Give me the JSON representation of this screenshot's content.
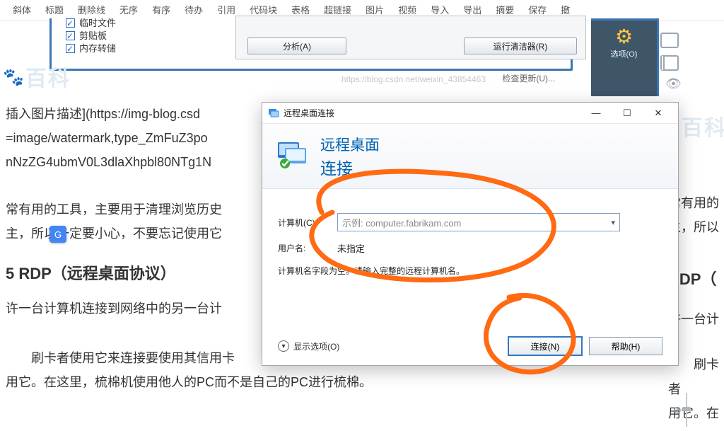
{
  "toolbar": {
    "items": [
      "斜体",
      "标题",
      "删除线",
      "无序",
      "有序",
      "待办",
      "引用",
      "代码块",
      "表格",
      "超链接",
      "图片",
      "视频",
      "导入",
      "导出",
      "摘要",
      "保存",
      "撤"
    ]
  },
  "cleaner": {
    "chk_top": "…………",
    "chk1": "临时文件",
    "chk2": "剪贴板",
    "chk3": "内存转储",
    "analyze": "分析(A)",
    "run": "运行清洁器(R)",
    "check_update": "检查更新(U)...",
    "options": "选项(O)"
  },
  "url_watermark": "https://blog.csdn.net/weixin_43854463",
  "blog": {
    "line_img1": "插入图片描述](https://img-blog.csd",
    "line_img2": "=image/watermark,type_ZmFuZ3po",
    "line_img3": "nNzZG4ubmV0L3dlaXhpbl80NTg1N",
    "p1a": "常有用的工具，主要用于清理浏览历史",
    "p1b": "主，所以一定要小心，不要忘记使用它",
    "h3": "5 RDP（远程桌面协议）",
    "p2": "许一台计算机连接到网络中的另一台计",
    "p3a": "　　刷卡者使用它来连接要使用其信用卡",
    "p3b": "用它。在这里，梳棉机使用他人的PC而不是自己的PC进行梳棉。",
    "r1": "常有用的",
    "r2": "主，所以",
    "r3": "RDP（",
    "r4": "许一台计",
    "r5": "　　刷卡者",
    "r6": "用它。在"
  },
  "rdp": {
    "window_title": "远程桌面连接",
    "banner_title": "远程桌面",
    "banner_sub": "连接",
    "label_computer": "计算机(C):",
    "placeholder": "示例: computer.fabrikam.com",
    "label_user": "用户名:",
    "user_value": "未指定",
    "hint": "计算机名字段为空。请输入完整的远程计算机名。",
    "show_options": "显示选项(O)",
    "btn_connect": "连接(N)",
    "btn_help": "帮助(H)"
  },
  "wm": {
    "baike": "百科"
  }
}
